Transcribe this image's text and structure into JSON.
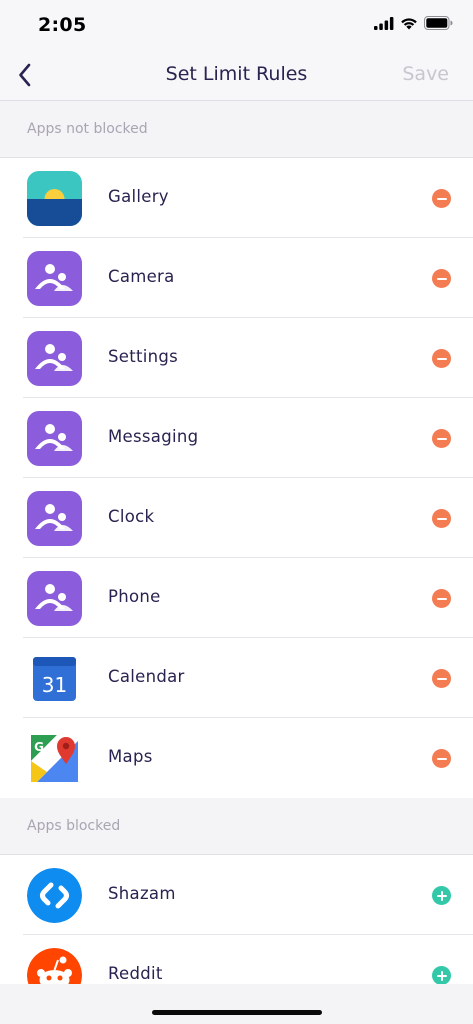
{
  "status_bar": {
    "time": "2:05"
  },
  "nav": {
    "title": "Set Limit Rules",
    "save_label": "Save"
  },
  "sections": {
    "not_blocked_header": "Apps not blocked",
    "blocked_header": "Apps blocked"
  },
  "apps_not_blocked": [
    {
      "name": "Gallery",
      "icon": "gallery-icon"
    },
    {
      "name": "Camera",
      "icon": "family-placeholder-icon"
    },
    {
      "name": "Settings",
      "icon": "family-placeholder-icon"
    },
    {
      "name": "Messaging",
      "icon": "family-placeholder-icon"
    },
    {
      "name": "Clock",
      "icon": "family-placeholder-icon"
    },
    {
      "name": "Phone",
      "icon": "family-placeholder-icon"
    },
    {
      "name": "Calendar",
      "icon": "calendar-icon",
      "icon_text": "31"
    },
    {
      "name": "Maps",
      "icon": "maps-icon",
      "icon_text": "G"
    }
  ],
  "apps_blocked": [
    {
      "name": "Shazam",
      "icon": "shazam-icon"
    },
    {
      "name": "Reddit",
      "icon": "reddit-icon"
    }
  ],
  "colors": {
    "remove": "#f47c52",
    "add": "#33c9a8",
    "placeholder_purple": "#8b5cdc",
    "title": "#2a2250",
    "save_disabled": "#c8c6ce"
  }
}
